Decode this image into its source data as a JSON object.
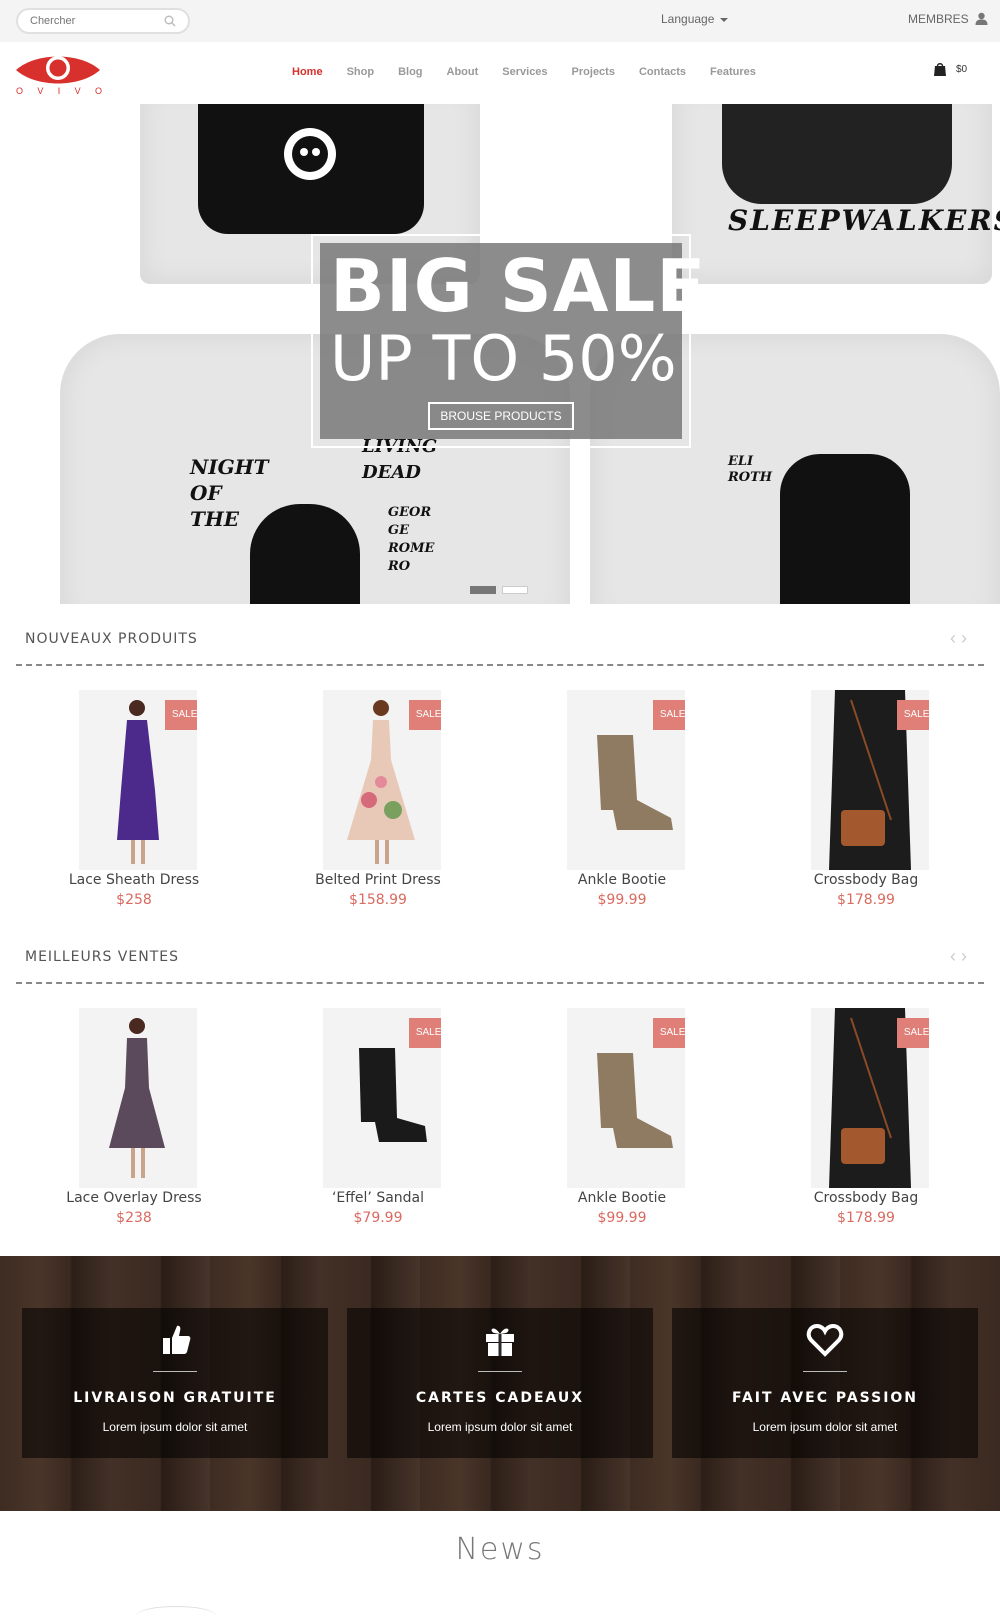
{
  "topbar": {
    "search_placeholder": "Chercher",
    "language_label": "Language",
    "members_label": "MEMBRES"
  },
  "logo": {
    "letters": [
      "O",
      "V",
      "I",
      "V",
      "O"
    ],
    "brand_color": "#d8302c"
  },
  "nav": {
    "items": [
      "Home",
      "Shop",
      "Blog",
      "About",
      "Services",
      "Projects",
      "Contacts",
      "Features"
    ],
    "active": "Home"
  },
  "cart": {
    "amount": "$0"
  },
  "hero": {
    "headline": "BIG SALE",
    "subline": "UP TO 50%",
    "button": "BROUSE PRODUCTS",
    "shirt_texts": {
      "sleepwalkers": "SLEEPWALKERS",
      "night": "NIGHT OF THE",
      "living_dead": "LIVING DEAD",
      "george": "GEOR GE ROME RO",
      "eli": "ELI ROTH"
    },
    "slides": 2,
    "active_slide": 1
  },
  "sections": [
    {
      "title": "NOUVEAUX PRODUITS",
      "products": [
        {
          "name": "Lace Sheath Dress",
          "price": "$258",
          "badge": "SALE!"
        },
        {
          "name": "Belted Print Dress",
          "price": "$158.99",
          "badge": "SALE!"
        },
        {
          "name": "Ankle Bootie",
          "price": "$99.99",
          "badge": "SALE!"
        },
        {
          "name": "Crossbody Bag",
          "price": "$178.99",
          "badge": "SALE!"
        }
      ]
    },
    {
      "title": "MEILLEURS VENTES",
      "products": [
        {
          "name": "Lace Overlay Dress",
          "price": "$238",
          "badge": ""
        },
        {
          "name": "‘Effel’ Sandal",
          "price": "$79.99",
          "badge": "SALE!"
        },
        {
          "name": "Ankle Bootie",
          "price": "$99.99",
          "badge": "SALE!"
        },
        {
          "name": "Crossbody Bag",
          "price": "$178.99",
          "badge": "SALE!"
        }
      ]
    }
  ],
  "features": [
    {
      "icon": "thumbs-up-icon",
      "title": "LIVRAISON GRATUITE",
      "text": "Lorem ipsum dolor sit amet"
    },
    {
      "icon": "gift-icon",
      "title": "CARTES CADEAUX",
      "text": "Lorem ipsum dolor sit amet"
    },
    {
      "icon": "heart-icon",
      "title": "FAIT AVEC PASSION",
      "text": "Lorem ipsum dolor sit amet"
    }
  ],
  "news": {
    "title": "News"
  },
  "colors": {
    "accent": "#d8302c",
    "price": "#d96a5f",
    "badge": "#e07f78",
    "wood": "#3e2c22"
  }
}
